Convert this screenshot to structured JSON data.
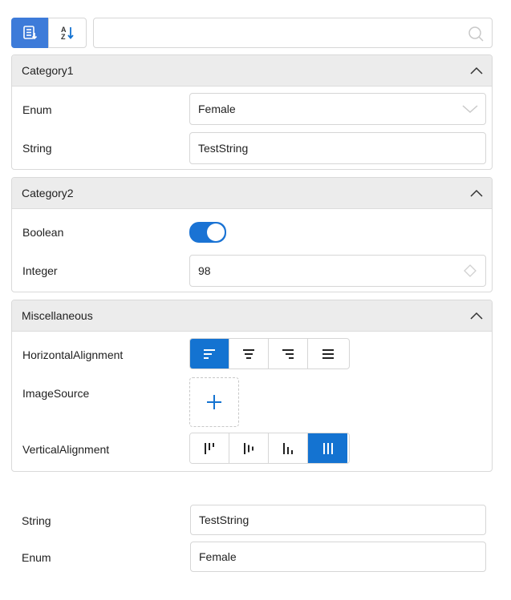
{
  "toolbar": {
    "categorize_icon": "categorize-icon",
    "sort_icon": "sort-az-icon",
    "search_value": "",
    "search_icon": "search-icon"
  },
  "categories": [
    {
      "title": "Category1",
      "rows": [
        {
          "label": "Enum",
          "value": "Female",
          "editor": "dropdown"
        },
        {
          "label": "String",
          "value": "TestString",
          "editor": "text"
        }
      ]
    },
    {
      "title": "Category2",
      "rows": [
        {
          "label": "Boolean",
          "value": "true",
          "editor": "toggle"
        },
        {
          "label": "Integer",
          "value": "98",
          "editor": "numeric"
        }
      ]
    },
    {
      "title": "Miscellaneous",
      "rows": [
        {
          "label": "HorizontalAlignment",
          "selected": "Left",
          "options": [
            "Left",
            "Center",
            "Right",
            "Stretch"
          ],
          "editor": "segmented"
        },
        {
          "label": "ImageSource",
          "editor": "image"
        },
        {
          "label": "VerticalAlignment",
          "selected": "Stretch",
          "options": [
            "Top",
            "Center",
            "Bottom",
            "Stretch"
          ],
          "editor": "segmented"
        }
      ]
    }
  ],
  "loose_fields": [
    {
      "label": "String",
      "value": "TestString"
    },
    {
      "label": "Enum",
      "value": "Female"
    }
  ],
  "colors": {
    "accent": "#1473d1",
    "toolbar_active": "#3d7bd9",
    "header_bg": "#ececec"
  }
}
